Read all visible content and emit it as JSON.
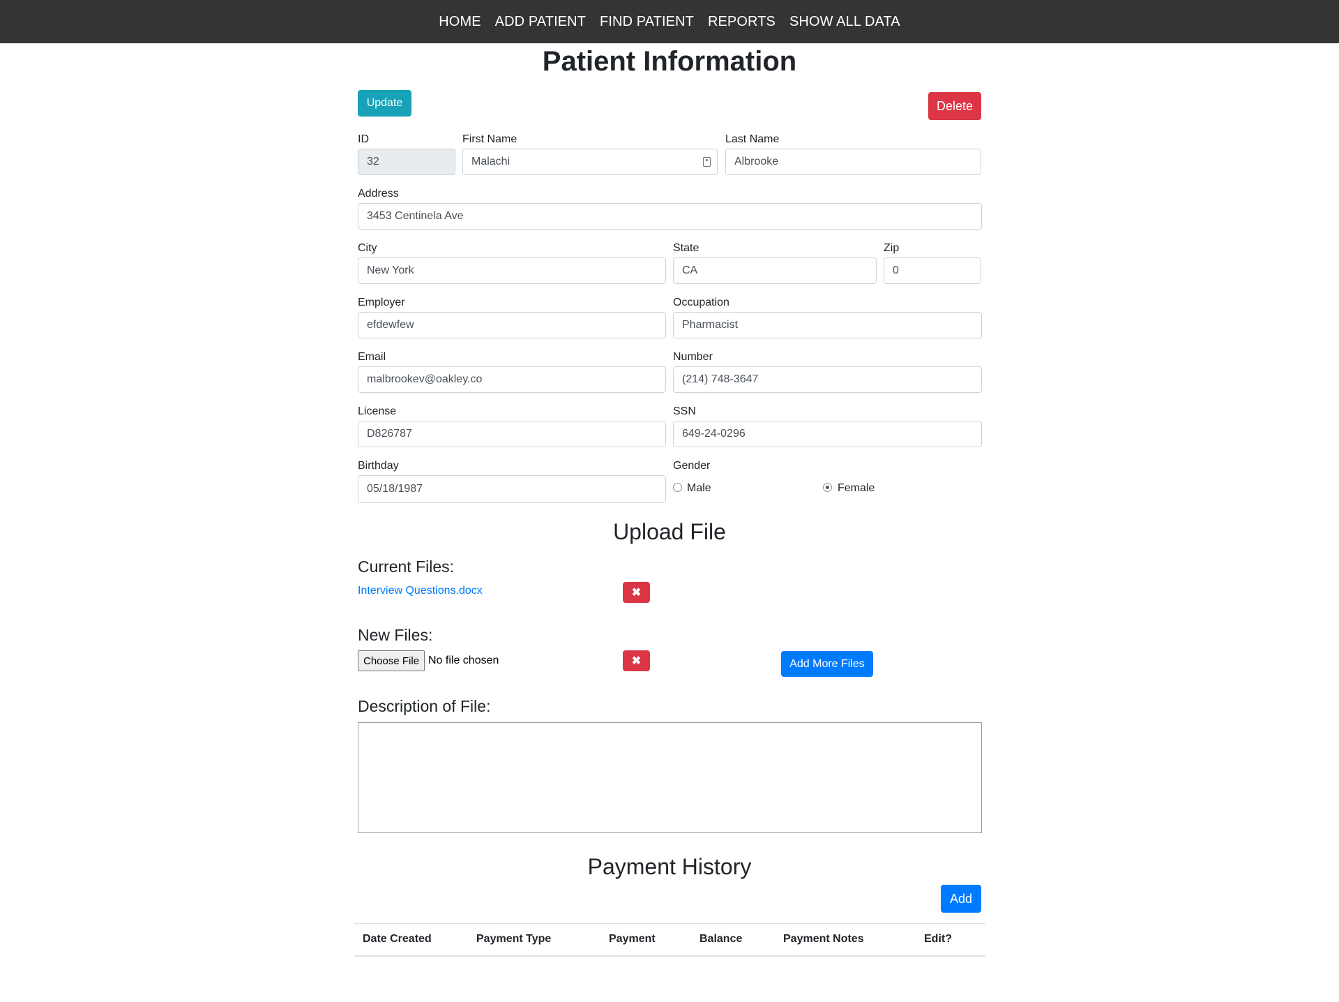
{
  "nav": {
    "items": [
      "HOME",
      "ADD PATIENT",
      "FIND PATIENT",
      "REPORTS",
      "SHOW ALL DATA"
    ]
  },
  "page_title": "Patient Information",
  "actions": {
    "update_label": "Update",
    "delete_label": "Delete"
  },
  "form": {
    "id": {
      "label": "ID",
      "value": "32"
    },
    "first_name": {
      "label": "First Name",
      "value": "Malachi"
    },
    "last_name": {
      "label": "Last Name",
      "value": "Albrooke"
    },
    "address": {
      "label": "Address",
      "value": "3453 Centinela Ave"
    },
    "city": {
      "label": "City",
      "value": "New York"
    },
    "state": {
      "label": "State",
      "value": "CA"
    },
    "zip": {
      "label": "Zip",
      "value": "0"
    },
    "employer": {
      "label": "Employer",
      "value": "efdewfew"
    },
    "occupation": {
      "label": "Occupation",
      "value": "Pharmacist"
    },
    "email": {
      "label": "Email",
      "value": "malbrookev@oakley.co"
    },
    "number": {
      "label": "Number",
      "value": "(214) 748-3647"
    },
    "license": {
      "label": "License",
      "value": "D826787"
    },
    "ssn": {
      "label": "SSN",
      "value": "649-24-0296"
    },
    "birthday": {
      "label": "Birthday",
      "value": "05/18/1987"
    },
    "gender": {
      "label": "Gender",
      "options": [
        "Male",
        "Female"
      ],
      "selected": "Female"
    }
  },
  "upload": {
    "title": "Upload File",
    "current_files_heading": "Current Files:",
    "current_files": [
      "Interview Questions.docx"
    ],
    "new_files_heading": "New Files:",
    "choose_file_label": "Choose File",
    "no_file_text": "No file chosen",
    "add_more_label": "Add More Files",
    "remove_glyph": "✖",
    "description_heading": "Description of File:"
  },
  "payment": {
    "title": "Payment History",
    "add_label": "Add",
    "columns": [
      "Date Created",
      "Payment Type",
      "Payment",
      "Balance",
      "Payment Notes",
      "Edit?"
    ]
  },
  "colors": {
    "navbar": "#343434",
    "info": "#17a2b8",
    "danger": "#dc3545",
    "primary": "#007bff"
  }
}
